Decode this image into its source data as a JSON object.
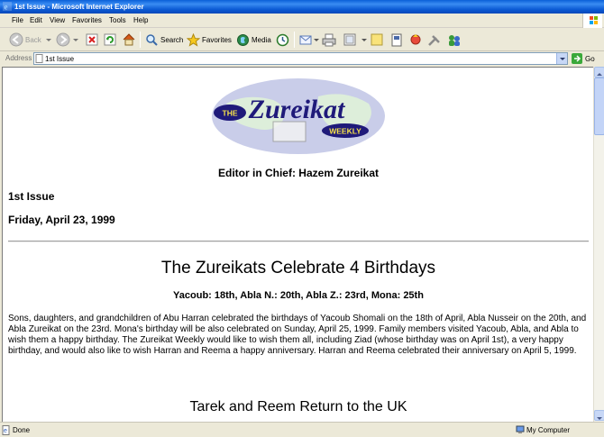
{
  "window": {
    "title": "1st Issue - Microsoft Internet Explorer"
  },
  "menu": [
    "File",
    "Edit",
    "View",
    "Favorites",
    "Tools",
    "Help"
  ],
  "toolbar": {
    "back_label": "Back",
    "search_label": "Search",
    "favorites_label": "Favorites",
    "media_label": "Media"
  },
  "address": {
    "label": "Address",
    "value": "1st Issue",
    "go_label": "Go"
  },
  "page": {
    "logo": {
      "the": "THE",
      "name": "Zureikat",
      "weekly": "WEEKLY"
    },
    "editor": "Editor in Chief: Hazem Zureikat",
    "issue": "1st Issue",
    "date": "Friday, April 23, 1999",
    "headline": "The Zureikats Celebrate 4 Birthdays",
    "subhead": "Yacoub: 18th, Abla N.: 20th, Abla Z.: 23rd, Mona: 25th",
    "article": "Sons, daughters, and grandchildren of Abu Harran celebrated the birthdays of Yacoub Shomali on the 18th of April, Abla Nusseir on the 20th, and Abla Zureikat on the 23rd.  Mona's birthday will be also celebrated on Sunday, April 25, 1999.  Family members visited Yacoub, Abla, and Abla to wish them a happy birthday.  The Zureikat Weekly would like to wish them all, including Ziad (whose birthday was on April 1st), a very happy birthday, and would also like to wish Harran and Reema a happy anniversary.  Harran and Reema celebrated their anniversary on April 5, 1999.",
    "headline2": "Tarek and Reem Return to the UK"
  },
  "status": {
    "text": "Done",
    "zone": "My Computer"
  },
  "colors": {
    "titlebar": "#0a5fd8",
    "chrome": "#ece9d8",
    "logo_oval": "#c9cde9",
    "logo_text": "#1f1a7a"
  }
}
